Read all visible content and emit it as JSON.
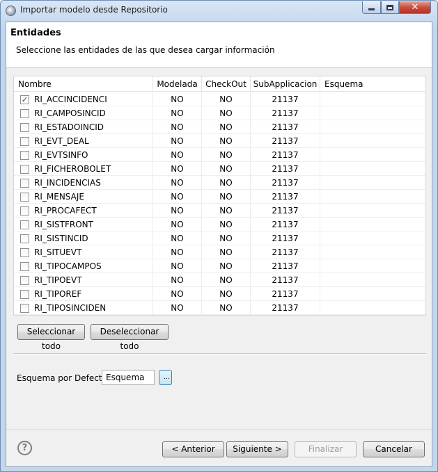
{
  "window": {
    "title": "Importar modelo desde Repositorio",
    "close_glyph": "✕"
  },
  "header": {
    "title": "Entidades",
    "description": "Seleccione las entidades de las que desea cargar información"
  },
  "table": {
    "columns": [
      "Nombre",
      "Modelada",
      "CheckOut",
      "SubApplicacion",
      "Esquema"
    ],
    "rows": [
      {
        "name": "RI_ACCINCIDENCI",
        "checked": true,
        "modelada": "NO",
        "checkout": "NO",
        "subapp": "21137",
        "esquema": ""
      },
      {
        "name": "RI_CAMPOSINCID",
        "checked": false,
        "modelada": "NO",
        "checkout": "NO",
        "subapp": "21137",
        "esquema": ""
      },
      {
        "name": "RI_ESTADOINCID",
        "checked": false,
        "modelada": "NO",
        "checkout": "NO",
        "subapp": "21137",
        "esquema": ""
      },
      {
        "name": "RI_EVT_DEAL",
        "checked": false,
        "modelada": "NO",
        "checkout": "NO",
        "subapp": "21137",
        "esquema": ""
      },
      {
        "name": "RI_EVTSINFO",
        "checked": false,
        "modelada": "NO",
        "checkout": "NO",
        "subapp": "21137",
        "esquema": ""
      },
      {
        "name": "RI_FICHEROBOLET",
        "checked": false,
        "modelada": "NO",
        "checkout": "NO",
        "subapp": "21137",
        "esquema": ""
      },
      {
        "name": "RI_INCIDENCIAS",
        "checked": false,
        "modelada": "NO",
        "checkout": "NO",
        "subapp": "21137",
        "esquema": ""
      },
      {
        "name": "RI_MENSAJE",
        "checked": false,
        "modelada": "NO",
        "checkout": "NO",
        "subapp": "21137",
        "esquema": ""
      },
      {
        "name": "RI_PROCAFECT",
        "checked": false,
        "modelada": "NO",
        "checkout": "NO",
        "subapp": "21137",
        "esquema": ""
      },
      {
        "name": "RI_SISTFRONT",
        "checked": false,
        "modelada": "NO",
        "checkout": "NO",
        "subapp": "21137",
        "esquema": ""
      },
      {
        "name": "RI_SISTINCID",
        "checked": false,
        "modelada": "NO",
        "checkout": "NO",
        "subapp": "21137",
        "esquema": ""
      },
      {
        "name": "RI_SITUEVT",
        "checked": false,
        "modelada": "NO",
        "checkout": "NO",
        "subapp": "21137",
        "esquema": ""
      },
      {
        "name": "RI_TIPOCAMPOS",
        "checked": false,
        "modelada": "NO",
        "checkout": "NO",
        "subapp": "21137",
        "esquema": ""
      },
      {
        "name": "RI_TIPOEVT",
        "checked": false,
        "modelada": "NO",
        "checkout": "NO",
        "subapp": "21137",
        "esquema": ""
      },
      {
        "name": "RI_TIPOREF",
        "checked": false,
        "modelada": "NO",
        "checkout": "NO",
        "subapp": "21137",
        "esquema": ""
      },
      {
        "name": "RI_TIPOSINCIDEN",
        "checked": false,
        "modelada": "NO",
        "checkout": "NO",
        "subapp": "21137",
        "esquema": ""
      }
    ]
  },
  "selection": {
    "select_all": "Seleccionar todo",
    "deselect_all": "Deseleccionar todo"
  },
  "default_schema": {
    "label": "Esquema por Defecto:",
    "value": "Esquema",
    "browse": "..."
  },
  "footer": {
    "help": "?",
    "back": "< Anterior",
    "next": "Siguiente >",
    "finish": "Finalizar",
    "cancel": "Cancelar"
  }
}
